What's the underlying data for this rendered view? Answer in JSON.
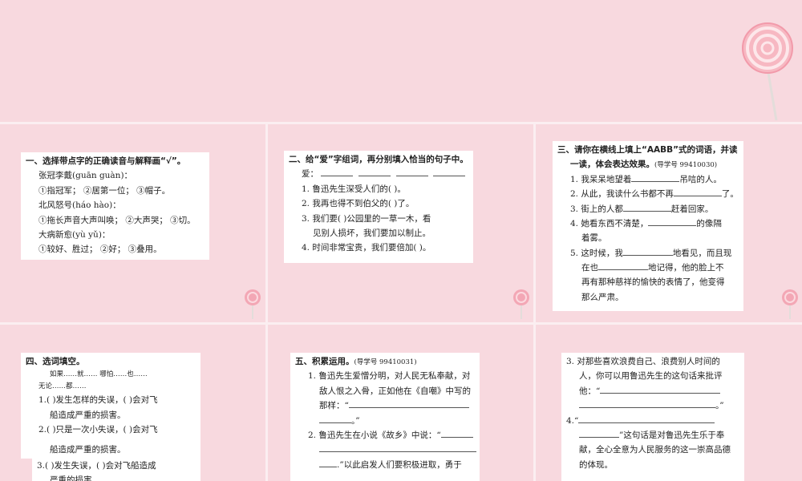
{
  "slide1": {
    "title": "一、选择带点字的正确读音与解释画“√”。",
    "lines": [
      "张冠李戴(guān  guàn)：",
      "①指冠军；  ②居第一位；  ③帽子。",
      "北风怒号(háo  hào)：",
      "①拖长声音大声叫唤；  ②大声哭；  ③切。",
      "大病新愈(yù  yǔ)：",
      "①较好、胜过；  ②好；  ③叠用。"
    ]
  },
  "slide2": {
    "title": "二、给“爱”字组词，再分别填入恰当的句子中。",
    "ai_label": "爱：",
    "items": [
      "1. 鲁迅先生深受人们的(          )。",
      "2. 我再也得不到伯父的(          )了。",
      "3. 我们要(          )公园里的一草一木，看",
      "见别人损坏，我们要加以制止。",
      "4. 时间非常宝贵，我们要倍加(          )。"
    ]
  },
  "slide3": {
    "title_line1": "三、请你在横线上填上“AABB”式的词语，并读",
    "title_line2": "一读，体会表达效果。",
    "guide": "(导学号 99410030)",
    "items": [
      {
        "pre": "1. 我呆呆地望着",
        "post": "吊唁的人。"
      },
      {
        "pre": "2. 从此，我读什么书都不再",
        "post": "了。"
      },
      {
        "pre": "3. 街上的人都",
        "post": "赶着回家。"
      },
      {
        "pre": "4. 她看东西不清楚，",
        "post": "的像隔"
      },
      {
        "pre": "着雾。",
        "post": ""
      },
      {
        "pre": "5. 这时候，我",
        "post": "地看见，而且现"
      },
      {
        "pre": "在也",
        "post": "地记得，他的脸上不"
      },
      {
        "pre": "再有那种慈祥的愉快的表情了，他变得",
        "post": ""
      },
      {
        "pre": "那么严肃。",
        "post": ""
      }
    ]
  },
  "slide4": {
    "title": "四、选词填空。",
    "options1": "如果……就……        哪怕……也……",
    "options2": "无论……都……",
    "items": [
      "1.(        )发生怎样的失误，(      )会对飞",
      "船造成严重的损害。",
      "2.(        )只是一次小失误，(      )会对飞",
      "船造成严重的损害。",
      "3.(        )发生失误，(      )会对飞船造成",
      "严重的损害。"
    ]
  },
  "slide5": {
    "title": "五、积累运用。",
    "guide": "(导学号 99410031)",
    "items": [
      "1. 鲁迅先生爱憎分明，对人民无私奉献，对",
      "敌人恨之入骨，正如他在《自嘲》中写的",
      "那样：“",
      "。”",
      "2. 鲁迅先生在小说《故乡》中说：“",
      "",
      ".”以此启发人们要积极进取，勇于"
    ]
  },
  "slide6": {
    "items": [
      "3. 对那些喜欢浪费自己、浪费别人时间的",
      "人，你可以用鲁迅先生的这句话来批评",
      "他：“",
      "。”",
      "4.“",
      "”这句话是对鲁迅先生乐于奉",
      "献，全心全意为人民服务的这一崇高品德",
      "的体现。"
    ]
  }
}
